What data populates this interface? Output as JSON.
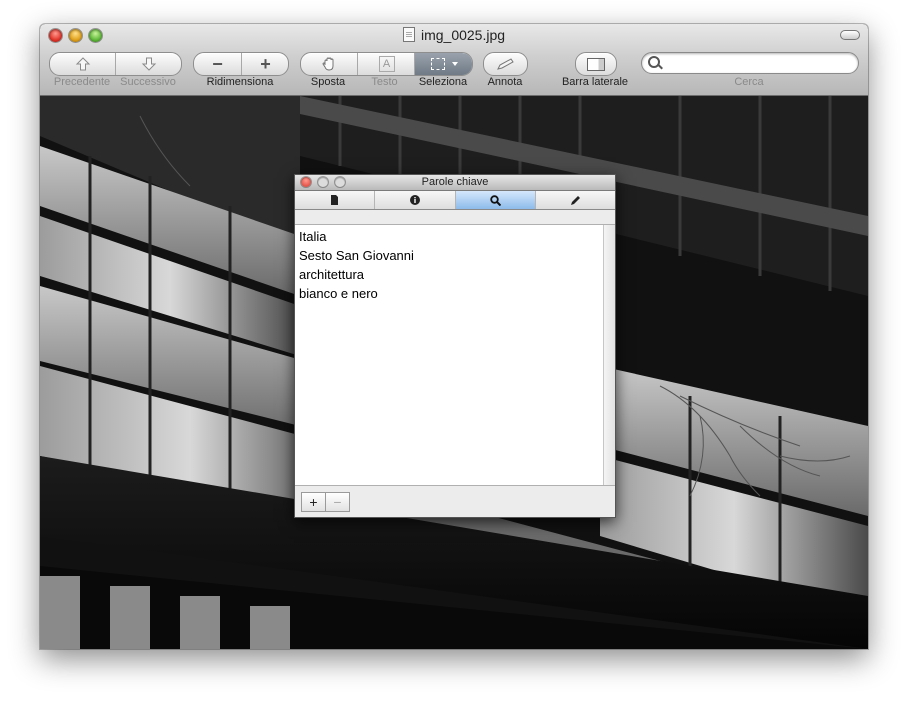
{
  "window": {
    "title": "img_0025.jpg"
  },
  "toolbar": {
    "prev_label": "Precedente",
    "next_label": "Successivo",
    "resize_label": "Ridimensiona",
    "move_label": "Sposta",
    "text_label": "Testo",
    "select_label": "Seleziona",
    "annotate_label": "Annota",
    "sidebar_label": "Barra laterale",
    "search_label": "Cerca",
    "search_value": "",
    "zoom_out_glyph": "−",
    "zoom_in_glyph": "+",
    "text_tool_glyph": "A"
  },
  "inspector": {
    "title": "Parole chiave",
    "tabs": [
      {
        "icon": "document-icon"
      },
      {
        "icon": "info-icon"
      },
      {
        "icon": "magnifier-icon",
        "active": true
      },
      {
        "icon": "pencil-icon"
      }
    ],
    "keywords": [
      "Italia",
      "Sesto San Giovanni",
      "architettura",
      "bianco e nero"
    ],
    "add_glyph": "+",
    "remove_glyph": "−"
  },
  "colors": {
    "active_tab": "#8dbbeb",
    "close_red": "#e0352b",
    "minimize_yellow": "#e0a11c",
    "zoom_green": "#5fb83a"
  }
}
